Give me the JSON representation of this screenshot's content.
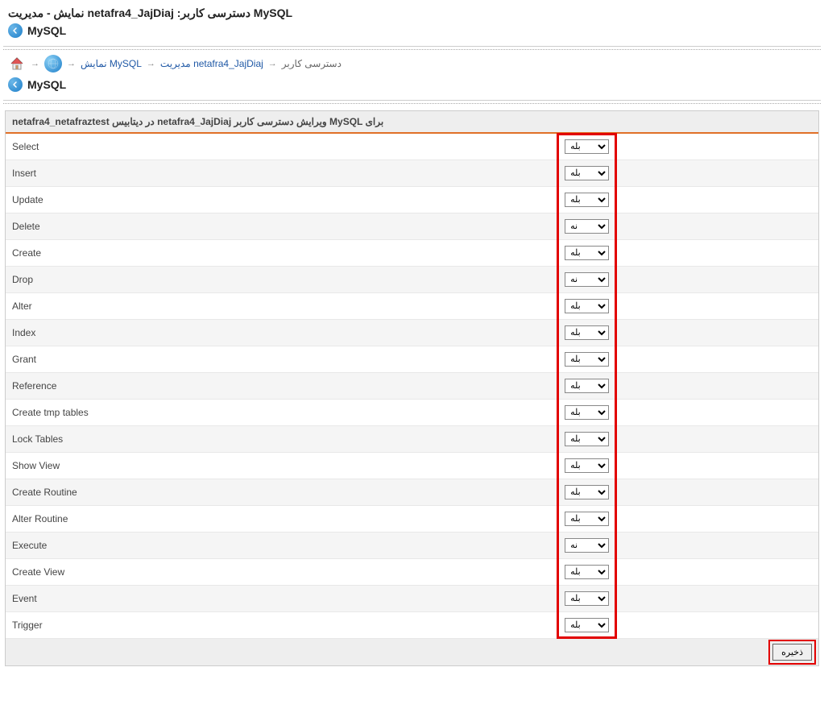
{
  "header": {
    "title": "نمایش - مدیریت netafra4_JajDiaj :دسترسی کاربر MySQL",
    "subtitle": "MySQL"
  },
  "breadcrumb": {
    "items": [
      {
        "label": "نمایش MySQL",
        "link": true
      },
      {
        "label": "مدیریت netafra4_JajDiaj",
        "link": true
      },
      {
        "label": "دسترسی کاربر",
        "link": false
      }
    ],
    "section": "MySQL"
  },
  "panel": {
    "title": "netafra4_netafraztest در دیتابیس netafra4_JajDiaj ویرایش دسترسی کاربر MySQL برای"
  },
  "options": {
    "yes": "بله",
    "no": "نه"
  },
  "permissions": [
    {
      "label": "Select",
      "value": "yes"
    },
    {
      "label": "Insert",
      "value": "yes"
    },
    {
      "label": "Update",
      "value": "yes"
    },
    {
      "label": "Delete",
      "value": "no"
    },
    {
      "label": "Create",
      "value": "yes"
    },
    {
      "label": "Drop",
      "value": "no"
    },
    {
      "label": "Alter",
      "value": "yes"
    },
    {
      "label": "Index",
      "value": "yes"
    },
    {
      "label": "Grant",
      "value": "yes"
    },
    {
      "label": "Reference",
      "value": "yes"
    },
    {
      "label": "Create tmp tables",
      "value": "yes"
    },
    {
      "label": "Lock Tables",
      "value": "yes"
    },
    {
      "label": "Show View",
      "value": "yes"
    },
    {
      "label": "Create Routine",
      "value": "yes"
    },
    {
      "label": "Alter Routine",
      "value": "yes"
    },
    {
      "label": "Execute",
      "value": "no"
    },
    {
      "label": "Create View",
      "value": "yes"
    },
    {
      "label": "Event",
      "value": "yes"
    },
    {
      "label": "Trigger",
      "value": "yes"
    }
  ],
  "footer": {
    "save": "ذخیره"
  }
}
